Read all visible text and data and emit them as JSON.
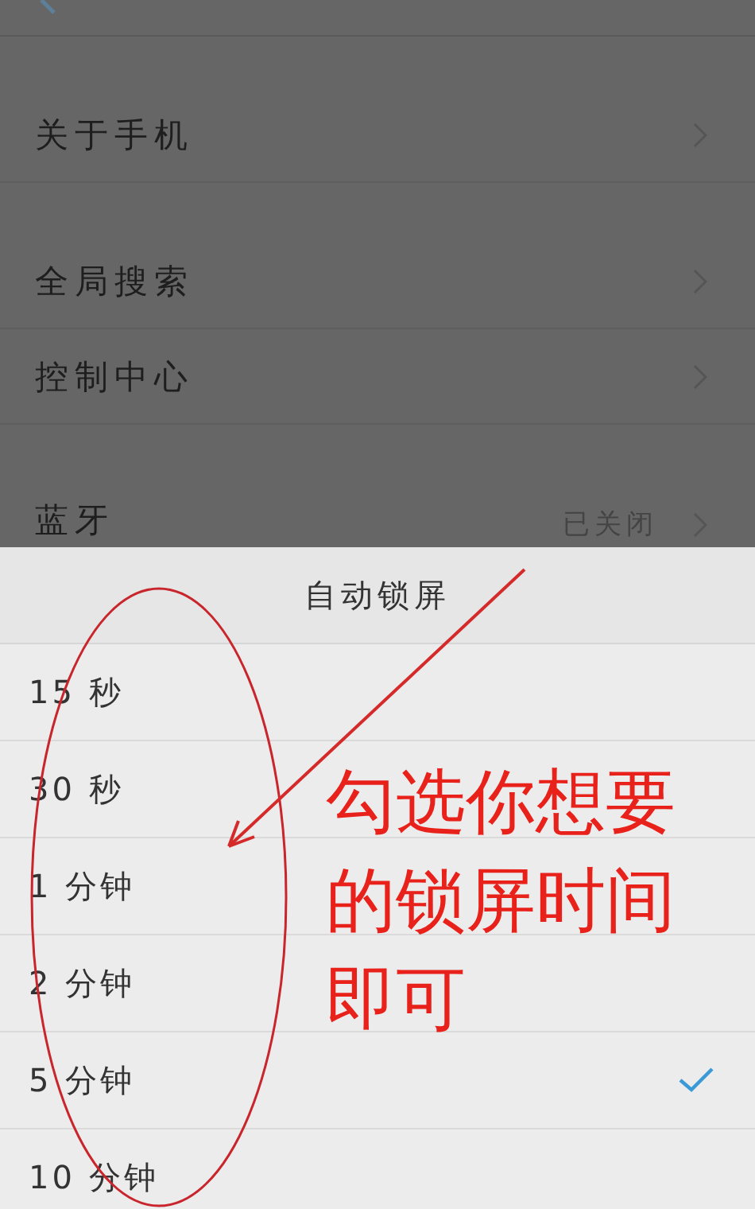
{
  "settings_groups": [
    [
      {
        "label": "关于手机"
      }
    ],
    [
      {
        "label": "全局搜索"
      },
      {
        "label": "控制中心"
      }
    ],
    [
      {
        "label": "蓝牙",
        "value": "已关闭"
      }
    ]
  ],
  "sheet": {
    "title": "自动锁屏",
    "options": [
      {
        "label": "15 秒",
        "selected": false
      },
      {
        "label": "30 秒",
        "selected": false
      },
      {
        "label": "1 分钟",
        "selected": false
      },
      {
        "label": "2 分钟",
        "selected": false
      },
      {
        "label": "5 分钟",
        "selected": true
      },
      {
        "label": "10 分钟",
        "selected": false
      }
    ]
  },
  "annotation": {
    "text": "勾选你想要的锁屏时间即可"
  }
}
